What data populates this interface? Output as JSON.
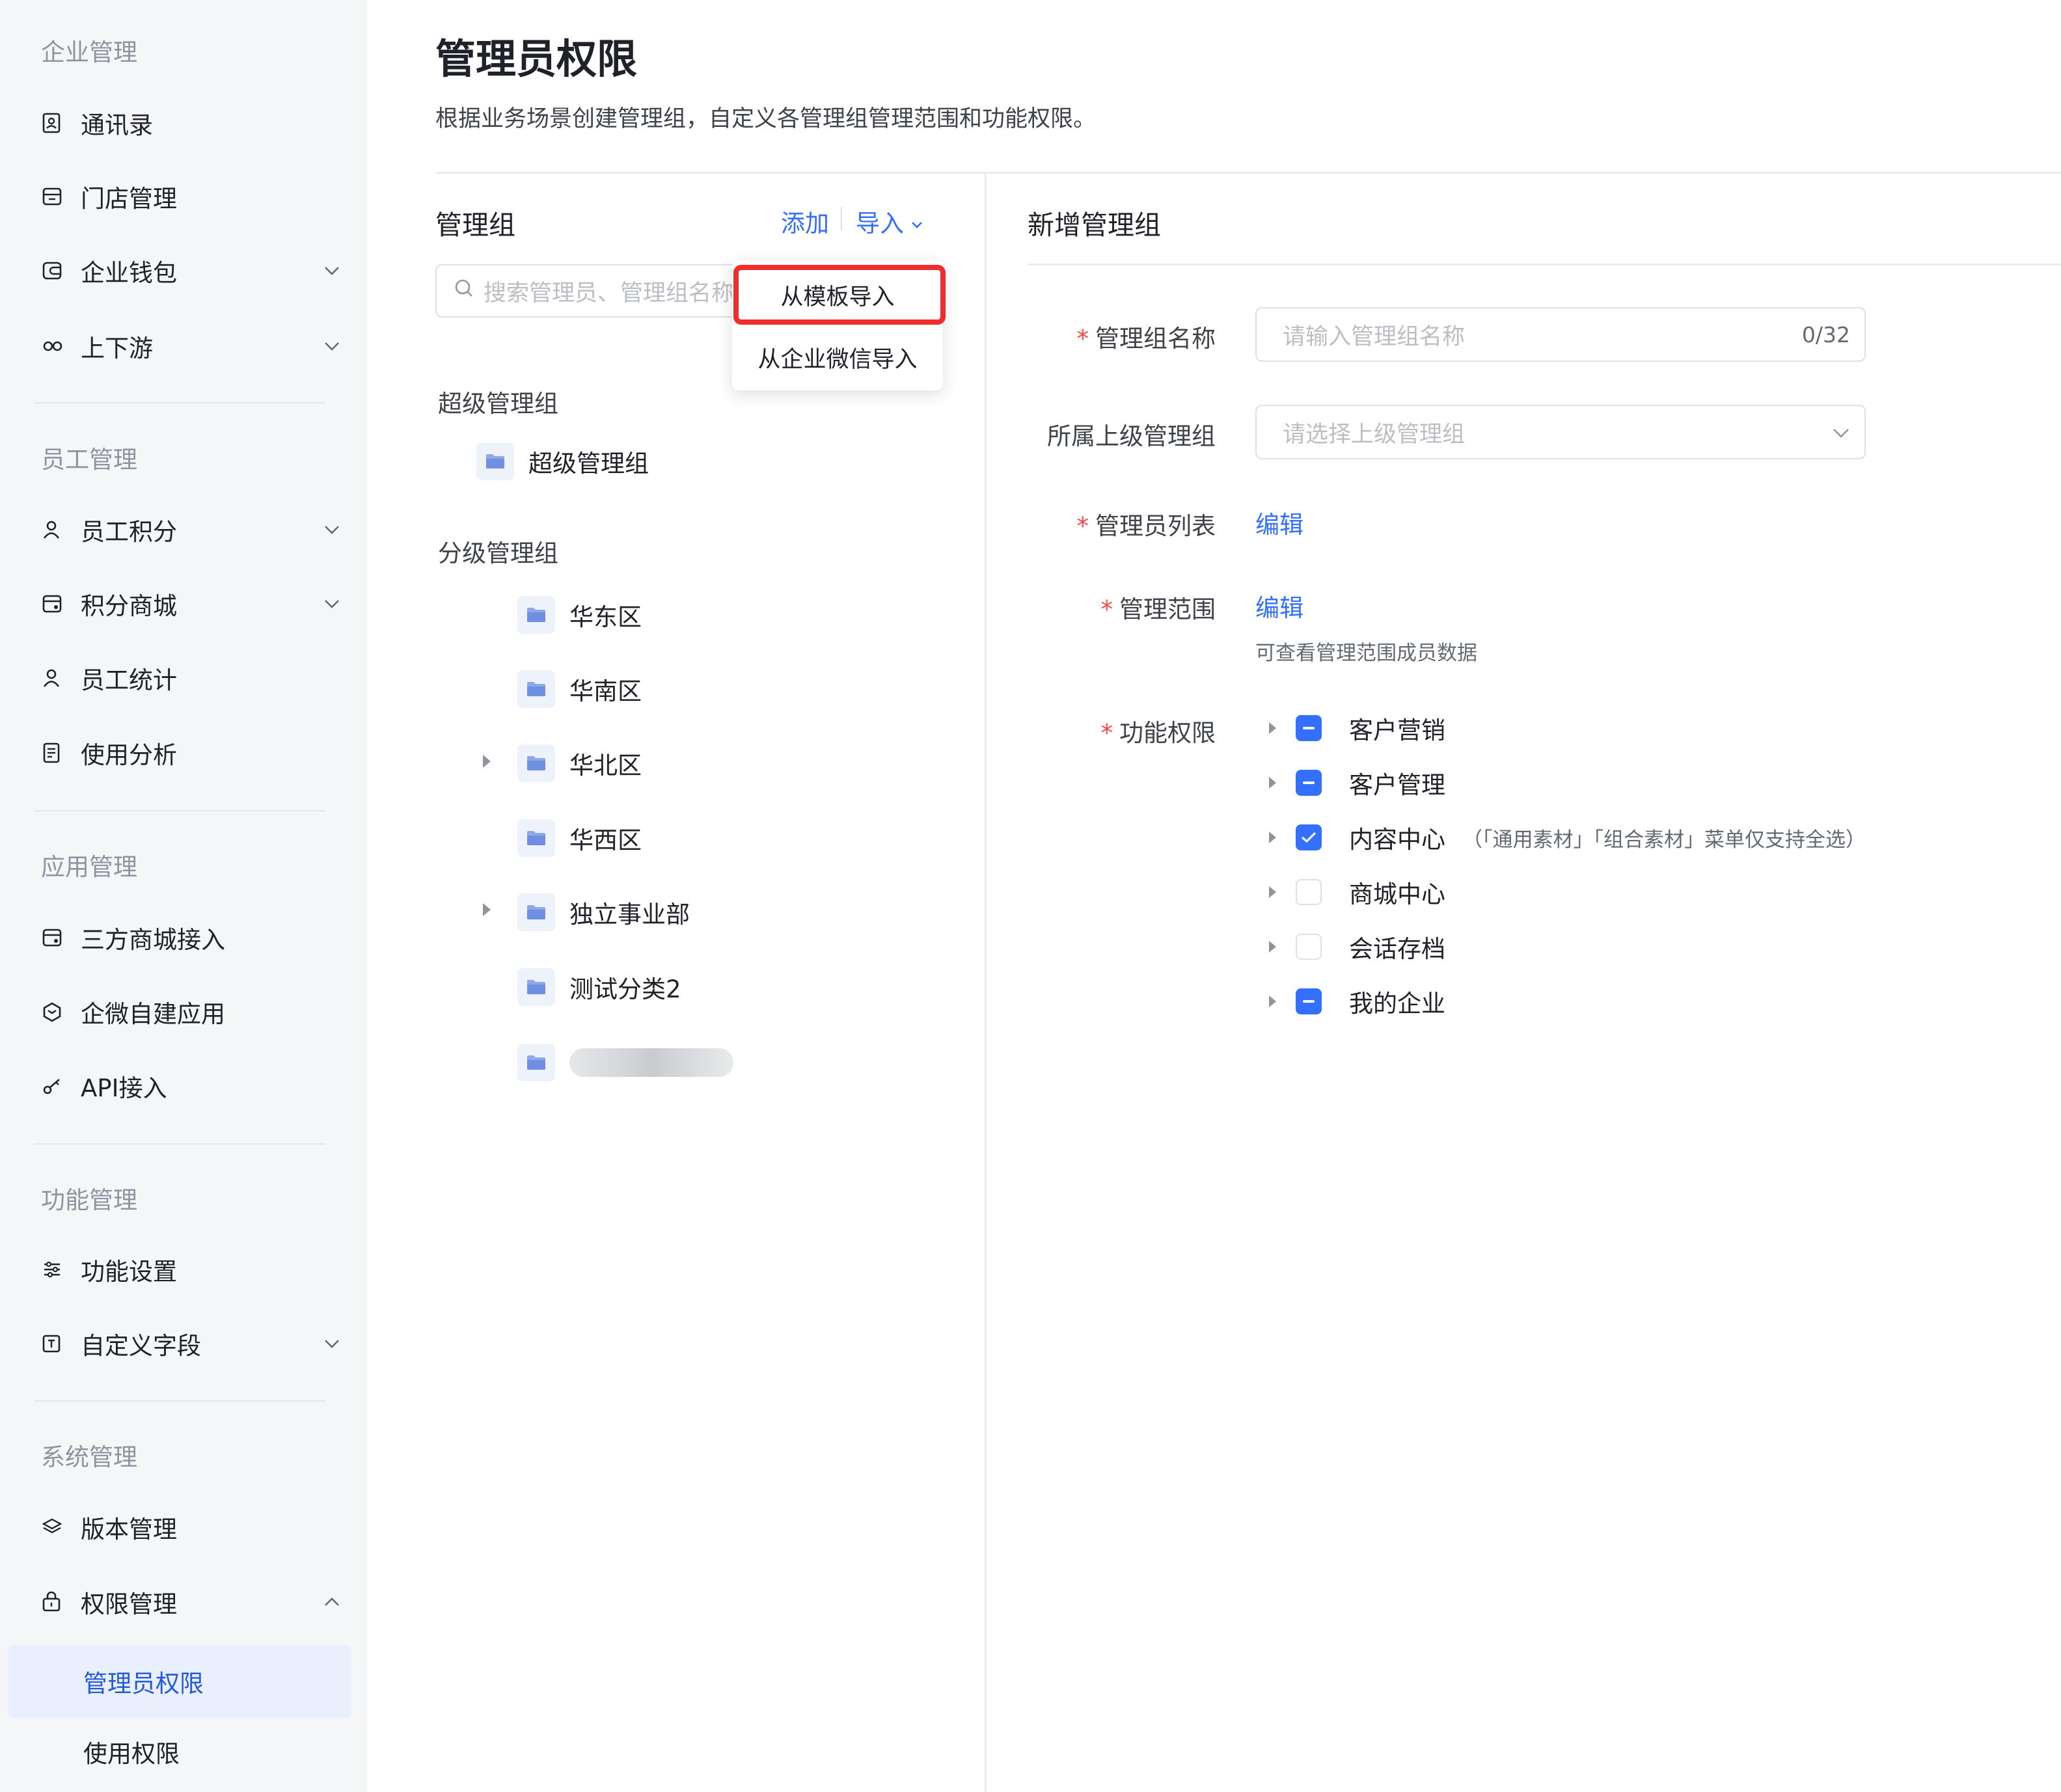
{
  "sidebar": {
    "sections": [
      {
        "title": "企业管理"
      },
      {
        "title": "员工管理"
      },
      {
        "title": "应用管理"
      },
      {
        "title": "功能管理"
      },
      {
        "title": "系统管理"
      }
    ],
    "items": [
      {
        "label": "通讯录",
        "icon": "contacts-icon"
      },
      {
        "label": "门店管理",
        "icon": "store-icon"
      },
      {
        "label": "企业钱包",
        "icon": "wallet-icon"
      },
      {
        "label": "上下游",
        "icon": "link-icon"
      },
      {
        "label": "员工积分",
        "icon": "user-icon"
      },
      {
        "label": "积分商城",
        "icon": "mall-icon"
      },
      {
        "label": "员工统计",
        "icon": "user-icon"
      },
      {
        "label": "使用分析",
        "icon": "analysis-icon"
      },
      {
        "label": "三方商城接入",
        "icon": "mall-icon"
      },
      {
        "label": "企微自建应用",
        "icon": "app-icon"
      },
      {
        "label": "API接入",
        "icon": "key-icon"
      },
      {
        "label": "功能设置",
        "icon": "sliders-icon"
      },
      {
        "label": "自定义字段",
        "icon": "text-field-icon"
      },
      {
        "label": "版本管理",
        "icon": "layers-icon"
      },
      {
        "label": "权限管理",
        "icon": "lock-icon"
      },
      {
        "label": "管理员权限"
      },
      {
        "label": "使用权限"
      }
    ]
  },
  "header": {
    "title": "管理员权限",
    "description": "根据业务场景创建管理组，自定义各管理组管理范围和功能权限。"
  },
  "groups_panel": {
    "title": "管理组",
    "add_label": "添加",
    "import_label": "导入",
    "search_placeholder": "搜索管理员、管理组名称",
    "super_heading": "超级管理组",
    "super_group": "超级管理组",
    "sub_heading": "分级管理组",
    "sub_groups": [
      {
        "label": "华东区"
      },
      {
        "label": "华南区"
      },
      {
        "label": "华北区"
      },
      {
        "label": "华西区"
      },
      {
        "label": "独立事业部"
      },
      {
        "label": "测试分类2"
      }
    ]
  },
  "import_menu": {
    "items": [
      "从模板导入",
      "从企业微信导入"
    ]
  },
  "form": {
    "title": "新增管理组",
    "name_label": "管理组名称",
    "name_placeholder": "请输入管理组名称",
    "name_count": "0/32",
    "parent_label": "所属上级管理组",
    "parent_placeholder": "请选择上级管理组",
    "admins_label": "管理员列表",
    "admins_link": "编辑",
    "scope_label": "管理范围",
    "scope_link": "编辑",
    "scope_help": "可查看管理范围成员数据",
    "perm_label": "功能权限",
    "permissions": [
      {
        "label": "客户营销",
        "state": "partial"
      },
      {
        "label": "客户管理",
        "state": "partial"
      },
      {
        "label": "内容中心",
        "state": "checked",
        "note": "（「通用素材」「组合素材」菜单仅支持全选）"
      },
      {
        "label": "商城中心",
        "state": "unchecked"
      },
      {
        "label": "会话存档",
        "state": "unchecked"
      },
      {
        "label": "我的企业",
        "state": "partial"
      }
    ]
  },
  "colors": {
    "accent": "#3370ff",
    "active_bg": "#e9effc",
    "required": "#f54a45",
    "highlight_box": "#f02c2c"
  }
}
